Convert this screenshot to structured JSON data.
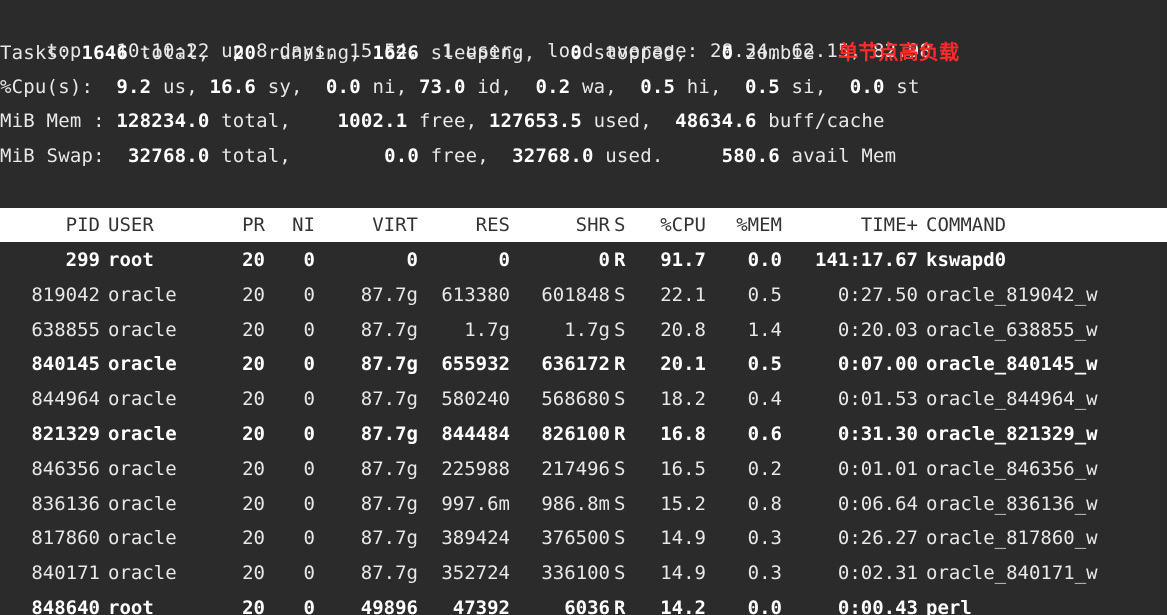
{
  "summary": {
    "line1": {
      "prefix": "top - 10:10:22 up 8 days, 15:54,  1 user,  load average: 28.34, 62.15, 82.98"
    },
    "line2": {
      "label": "Tasks: ",
      "total_val": "1646",
      "total_lbl": " total,  ",
      "running_val": "20",
      "running_lbl": " running, ",
      "sleeping_val": "1626",
      "sleeping_lbl": " sleeping,   ",
      "stopped_val": "0",
      "stopped_lbl": " stopped,   ",
      "zombie_val": "0",
      "zombie_lbl": " zombie  ",
      "annotation": "单节点高负载"
    },
    "line3": {
      "label": "%Cpu(s):  ",
      "us_val": "9.2",
      "us_lbl": " us, ",
      "sy_val": "16.6",
      "sy_lbl": " sy,  ",
      "ni_val": "0.0",
      "ni_lbl": " ni, ",
      "id_val": "73.0",
      "id_lbl": " id,  ",
      "wa_val": "0.2",
      "wa_lbl": " wa,  ",
      "hi_val": "0.5",
      "hi_lbl": " hi,  ",
      "si_val": "0.5",
      "si_lbl": " si,  ",
      "st_val": "0.0",
      "st_lbl": " st"
    },
    "line4": {
      "label": "MiB Mem : ",
      "total_val": "128234.0",
      "total_lbl": " total,    ",
      "free_val": "1002.1",
      "free_lbl": " free, ",
      "used_val": "127653.5",
      "used_lbl": " used,  ",
      "cache_val": "48634.6",
      "cache_lbl": " buff/cache"
    },
    "line5": {
      "label": "MiB Swap:  ",
      "total_val": "32768.0",
      "total_lbl": " total,        ",
      "free_val": "0.0",
      "free_lbl": " free,  ",
      "used_val": "32768.0",
      "used_lbl": " used.     ",
      "avail_val": "580.6",
      "avail_lbl": " avail Mem"
    }
  },
  "columns": {
    "pid": "PID",
    "user": "USER",
    "pr": "PR",
    "ni": "NI",
    "virt": "VIRT",
    "res": "RES",
    "shr": "SHR",
    "s": "S",
    "cpu": "%CPU",
    "mem": "%MEM",
    "time": "TIME+",
    "command": "COMMAND"
  },
  "processes": [
    {
      "pid": "299",
      "user": "root",
      "pr": "20",
      "ni": "0",
      "virt": "0",
      "res": "0",
      "shr": "0",
      "s": "R",
      "cpu": "91.7",
      "mem": "0.0",
      "time": "141:17.67",
      "command": "kswapd0",
      "bold": true
    },
    {
      "pid": "819042",
      "user": "oracle",
      "pr": "20",
      "ni": "0",
      "virt": "87.7g",
      "res": "613380",
      "shr": "601848",
      "s": "S",
      "cpu": "22.1",
      "mem": "0.5",
      "time": "0:27.50",
      "command": "oracle_819042_w",
      "bold": false
    },
    {
      "pid": "638855",
      "user": "oracle",
      "pr": "20",
      "ni": "0",
      "virt": "87.7g",
      "res": "1.7g",
      "shr": "1.7g",
      "s": "S",
      "cpu": "20.8",
      "mem": "1.4",
      "time": "0:20.03",
      "command": "oracle_638855_w",
      "bold": false
    },
    {
      "pid": "840145",
      "user": "oracle",
      "pr": "20",
      "ni": "0",
      "virt": "87.7g",
      "res": "655932",
      "shr": "636172",
      "s": "R",
      "cpu": "20.1",
      "mem": "0.5",
      "time": "0:07.00",
      "command": "oracle_840145_w",
      "bold": true
    },
    {
      "pid": "844964",
      "user": "oracle",
      "pr": "20",
      "ni": "0",
      "virt": "87.7g",
      "res": "580240",
      "shr": "568680",
      "s": "S",
      "cpu": "18.2",
      "mem": "0.4",
      "time": "0:01.53",
      "command": "oracle_844964_w",
      "bold": false
    },
    {
      "pid": "821329",
      "user": "oracle",
      "pr": "20",
      "ni": "0",
      "virt": "87.7g",
      "res": "844484",
      "shr": "826100",
      "s": "R",
      "cpu": "16.8",
      "mem": "0.6",
      "time": "0:31.30",
      "command": "oracle_821329_w",
      "bold": true
    },
    {
      "pid": "846356",
      "user": "oracle",
      "pr": "20",
      "ni": "0",
      "virt": "87.7g",
      "res": "225988",
      "shr": "217496",
      "s": "S",
      "cpu": "16.5",
      "mem": "0.2",
      "time": "0:01.01",
      "command": "oracle_846356_w",
      "bold": false
    },
    {
      "pid": "836136",
      "user": "oracle",
      "pr": "20",
      "ni": "0",
      "virt": "87.7g",
      "res": "997.6m",
      "shr": "986.8m",
      "s": "S",
      "cpu": "15.2",
      "mem": "0.8",
      "time": "0:06.64",
      "command": "oracle_836136_w",
      "bold": false
    },
    {
      "pid": "817860",
      "user": "oracle",
      "pr": "20",
      "ni": "0",
      "virt": "87.7g",
      "res": "389424",
      "shr": "376500",
      "s": "S",
      "cpu": "14.9",
      "mem": "0.3",
      "time": "0:26.27",
      "command": "oracle_817860_w",
      "bold": false
    },
    {
      "pid": "840171",
      "user": "oracle",
      "pr": "20",
      "ni": "0",
      "virt": "87.7g",
      "res": "352724",
      "shr": "336100",
      "s": "S",
      "cpu": "14.9",
      "mem": "0.3",
      "time": "0:02.31",
      "command": "oracle_840171_w",
      "bold": false
    },
    {
      "pid": "848640",
      "user": "root",
      "pr": "20",
      "ni": "0",
      "virt": "49896",
      "res": "47392",
      "shr": "6036",
      "s": "R",
      "cpu": "14.2",
      "mem": "0.0",
      "time": "0:00.43",
      "command": "perl",
      "bold": true
    }
  ],
  "colors": {
    "background": "#2b2b2b",
    "text": "#e8e8e8",
    "header_bg": "#ffffff",
    "annotation": "#ff2a2a"
  }
}
